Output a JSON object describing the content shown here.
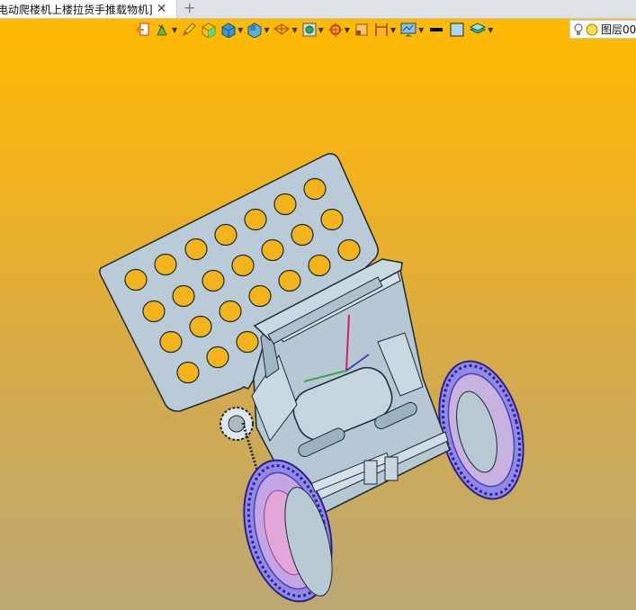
{
  "tab": {
    "title": "电动爬楼机上楼拉货手推载物机]",
    "close_glyph": "✕",
    "add_glyph": "+"
  },
  "toolbar": {
    "tools": [
      "exit-icon",
      "select-filter-icon",
      "pencil-icon",
      "solid-box-icon",
      "view-cube-icon",
      "view-orient-icon",
      "wireframe-icon",
      "render-style-icon",
      "snap-icon",
      "sketch-icon",
      "dimension-icon",
      "display-settings-icon",
      "color-black-icon",
      "color-light-blue-icon",
      "layer-stack-icon"
    ],
    "layer": {
      "name": "图层00"
    }
  },
  "colors": {
    "viewport_top": "#ffba00",
    "viewport_bottom": "#bba873",
    "model_body": "#b7c9d4",
    "model_edge": "#1e2a33",
    "tire": "#8a7ce6",
    "rim": "#c06fd0"
  }
}
